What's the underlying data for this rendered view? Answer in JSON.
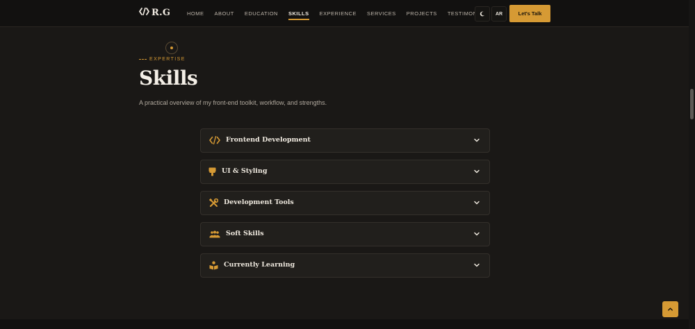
{
  "header": {
    "logo_text": "R.G",
    "logo_icon": "code-brackets-icon",
    "nav": [
      {
        "label": "HOME"
      },
      {
        "label": "ABOUT"
      },
      {
        "label": "EDUCATION"
      },
      {
        "label": "SKILLS",
        "active": true
      },
      {
        "label": "EXPERIENCE"
      },
      {
        "label": "SERVICES"
      },
      {
        "label": "PROJECTS"
      },
      {
        "label": "TESTIMONIALS"
      }
    ],
    "theme_icon": "moon-icon",
    "lang_label": "AR",
    "cta_label": "Let's Talk"
  },
  "section": {
    "eyebrow": "EXPERTISE",
    "title": "Skills",
    "subtitle": "A practical overview of my front-end toolkit, workflow, and strengths."
  },
  "accordion": [
    {
      "label": "Frontend Development",
      "icon": "code-icon"
    },
    {
      "label": "UI & Styling",
      "icon": "paint-brush-icon"
    },
    {
      "label": "Development Tools",
      "icon": "tools-icon"
    },
    {
      "label": "Soft Skills",
      "icon": "people-icon"
    },
    {
      "label": "Currently Learning",
      "icon": "learning-icon"
    }
  ],
  "colors": {
    "accent": "#d69a34",
    "background": "#1a1816",
    "card": "#211f1c"
  }
}
